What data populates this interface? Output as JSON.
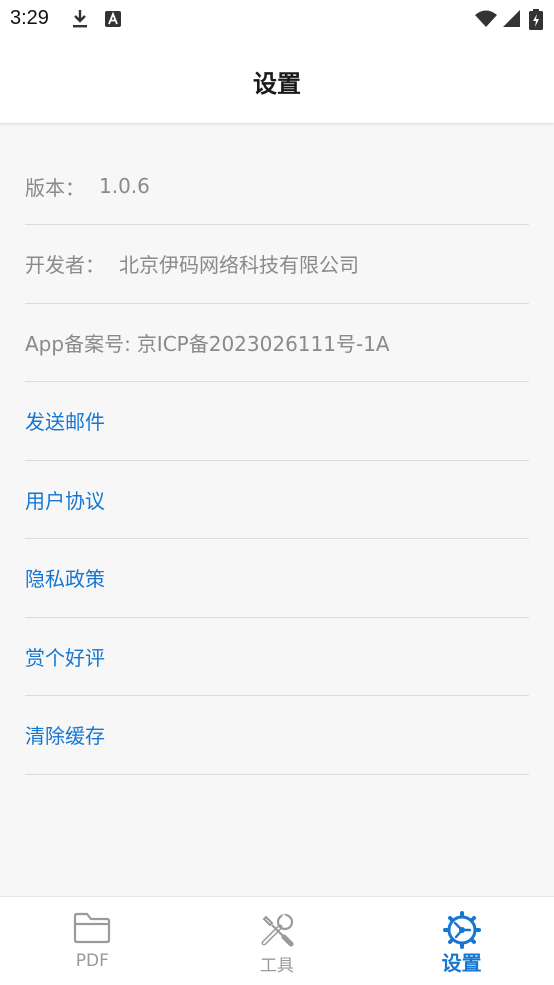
{
  "status_bar": {
    "time": "3:29",
    "icons": [
      "download-icon",
      "a-notification-icon",
      "wifi-icon",
      "signal-icon",
      "battery-charging-icon"
    ]
  },
  "header": {
    "title": "设置"
  },
  "settings": {
    "version": {
      "label": "版本：",
      "value": "1.0.6"
    },
    "developer": {
      "label": "开发者：",
      "value": "北京伊码网络科技有限公司"
    },
    "icp": {
      "label": "App备案号:",
      "value": "京ICP备2023026111号-1A"
    },
    "links": [
      {
        "label": "发送邮件"
      },
      {
        "label": "用户协议"
      },
      {
        "label": "隐私政策"
      },
      {
        "label": "赏个好评"
      },
      {
        "label": "清除缓存"
      }
    ]
  },
  "tabbar": {
    "tabs": [
      {
        "label": "PDF",
        "icon": "folder-icon",
        "active": false
      },
      {
        "label": "工具",
        "icon": "tools-icon",
        "active": false
      },
      {
        "label": "设置",
        "icon": "settings-gear-icon",
        "active": true
      }
    ]
  },
  "colors": {
    "accent": "#1677d2",
    "muted": "#8a8a8a",
    "background": "#f7f7f7"
  }
}
